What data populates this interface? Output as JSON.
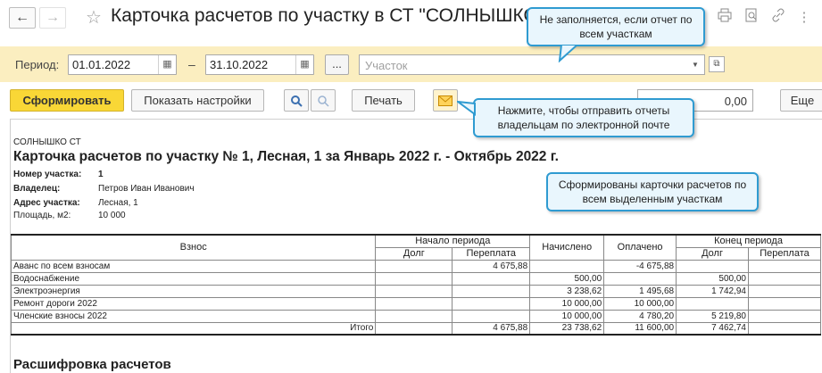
{
  "window": {
    "title": "Карточка расчетов по участку в СТ \"СОЛНЫШКО\"",
    "nav_back": "←",
    "nav_forward": "→",
    "star": "☆",
    "icons": [
      "print-icon",
      "preview-icon",
      "link-icon",
      "more-icon"
    ]
  },
  "period_bar": {
    "label": "Период:",
    "date_from": "01.01.2022",
    "dash": "–",
    "date_to": "31.10.2022",
    "dots_label": "...",
    "plot_placeholder": "Участок",
    "bg_color": "#fbeec0"
  },
  "toolbar": {
    "generate_label": "Сформировать",
    "show_settings_label": "Показать настройки",
    "print_label": "Печать",
    "sum_value": "0,00",
    "more_label": "Еще"
  },
  "report": {
    "org": "СОЛНЫШКО СТ",
    "title": "Карточка расчетов по участку № 1, Лесная, 1  за Январь 2022 г. - Октябрь 2022 г.",
    "fields": [
      {
        "key": "Номер участка:",
        "value": "1"
      },
      {
        "key": "Владелец:",
        "value": "Петров Иван Иванович"
      },
      {
        "key": "Адрес участка:",
        "value": "Лесная, 1"
      },
      {
        "key": "Площадь, м2:",
        "value": "10 000"
      }
    ],
    "table": {
      "h_fee": "Взнос",
      "h_start": "Начало периода",
      "h_accrued": "Начислено",
      "h_paid": "Оплачено",
      "h_end": "Конец периода",
      "h_debt": "Долг",
      "h_overpay": "Переплата",
      "rows": [
        {
          "name": "Аванс по всем взносам",
          "s_debt": "",
          "s_over": "4 675,88",
          "accrued": "",
          "paid": "-4 675,88",
          "e_debt": "",
          "e_over": ""
        },
        {
          "name": "Водоснабжение",
          "s_debt": "",
          "s_over": "",
          "accrued": "500,00",
          "paid": "",
          "e_debt": "500,00",
          "e_over": ""
        },
        {
          "name": "Электроэнергия",
          "s_debt": "",
          "s_over": "",
          "accrued": "3 238,62",
          "paid": "1 495,68",
          "e_debt": "1 742,94",
          "e_over": ""
        },
        {
          "name": "Ремонт дороги 2022",
          "s_debt": "",
          "s_over": "",
          "accrued": "10 000,00",
          "paid": "10 000,00",
          "e_debt": "",
          "e_over": ""
        },
        {
          "name": "Членские взносы 2022",
          "s_debt": "",
          "s_over": "",
          "accrued": "10 000,00",
          "paid": "4 780,20",
          "e_debt": "5 219,80",
          "e_over": ""
        }
      ],
      "total": {
        "name": "Итого",
        "s_debt": "",
        "s_over": "4 675,88",
        "accrued": "23 738,62",
        "paid": "11 600,00",
        "e_debt": "7 462,74",
        "e_over": ""
      }
    },
    "breakdown": "Расшифровка расчетов"
  },
  "tooltips": {
    "plot": "Не заполняется, если отчет по всем участкам",
    "mail": "Нажмите, чтобы отправить отчеты владельцам по электронной почте",
    "generated": "Сформированы карточки расчетов по всем выделенным участкам"
  }
}
